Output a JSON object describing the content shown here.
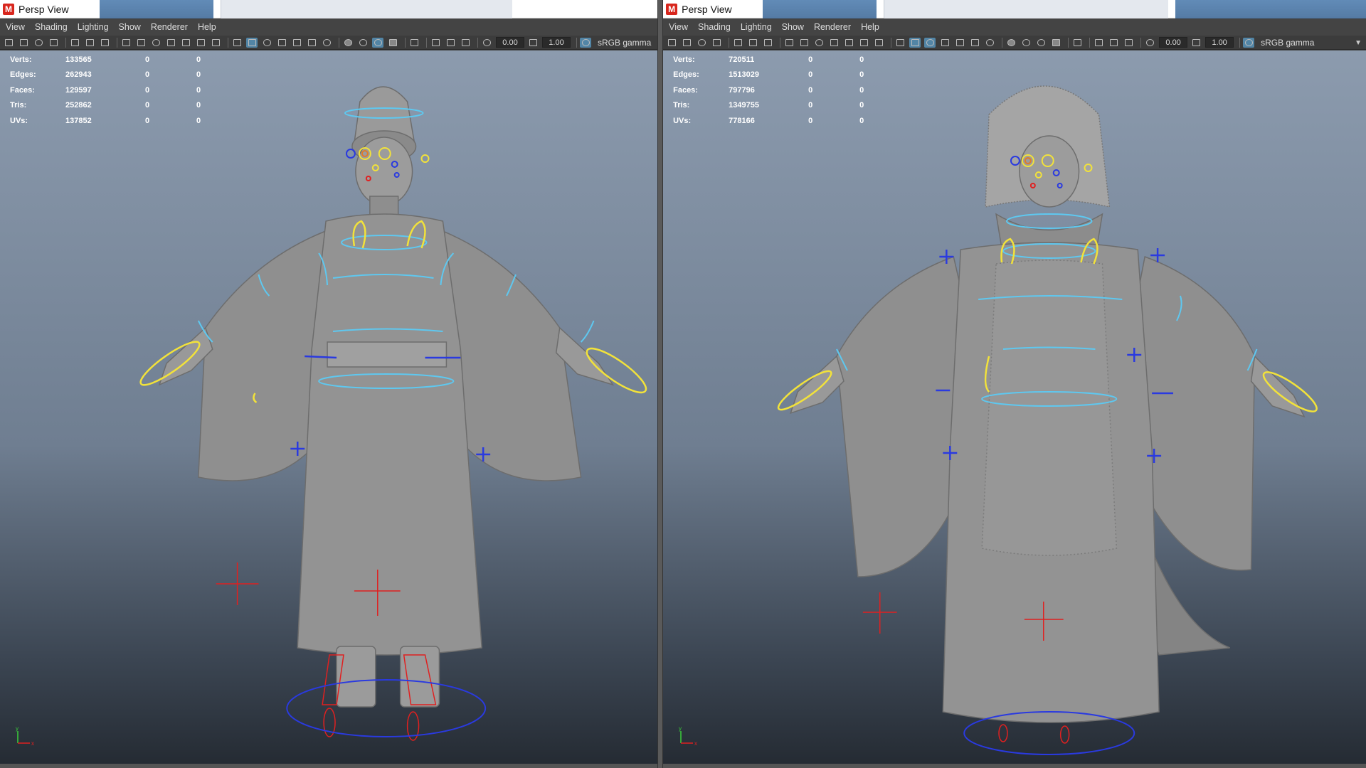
{
  "panes": [
    {
      "title": "Persp View",
      "menus": [
        "View",
        "Shading",
        "Lighting",
        "Show",
        "Renderer",
        "Help"
      ],
      "toolbar": {
        "field1": "0.00",
        "field2": "1.00",
        "color_space": "sRGB gamma"
      },
      "stats": [
        {
          "label": "Verts:",
          "value": "133565",
          "c2": "0",
          "c3": "0"
        },
        {
          "label": "Edges:",
          "value": "262943",
          "c2": "0",
          "c3": "0"
        },
        {
          "label": "Faces:",
          "value": "129597",
          "c2": "0",
          "c3": "0"
        },
        {
          "label": "Tris:",
          "value": "252862",
          "c2": "0",
          "c3": "0"
        },
        {
          "label": "UVs:",
          "value": "137852",
          "c2": "0",
          "c3": "0"
        }
      ],
      "axis": {
        "y": "y",
        "x": "x"
      }
    },
    {
      "title": "Persp View",
      "menus": [
        "View",
        "Shading",
        "Lighting",
        "Show",
        "Renderer",
        "Help"
      ],
      "toolbar": {
        "field1": "0.00",
        "field2": "1.00",
        "color_space": "sRGB gamma"
      },
      "stats": [
        {
          "label": "Verts:",
          "value": "720511",
          "c2": "0",
          "c3": "0"
        },
        {
          "label": "Edges:",
          "value": "1513029",
          "c2": "0",
          "c3": "0"
        },
        {
          "label": "Faces:",
          "value": "797796",
          "c2": "0",
          "c3": "0"
        },
        {
          "label": "Tris:",
          "value": "1349755",
          "c2": "0",
          "c3": "0"
        },
        {
          "label": "UVs:",
          "value": "778166",
          "c2": "0",
          "c3": "0"
        }
      ],
      "axis": {
        "y": "y",
        "x": "x"
      }
    }
  ],
  "colors": {
    "viewport_top": "#8c9bae",
    "viewport_bottom": "#242a32",
    "control_cyan": "#5ec8f0",
    "control_yellow": "#f2e23a",
    "control_red": "#e02020",
    "control_blue": "#2a3ae0",
    "mesh_gray": "#8f8f8f"
  }
}
